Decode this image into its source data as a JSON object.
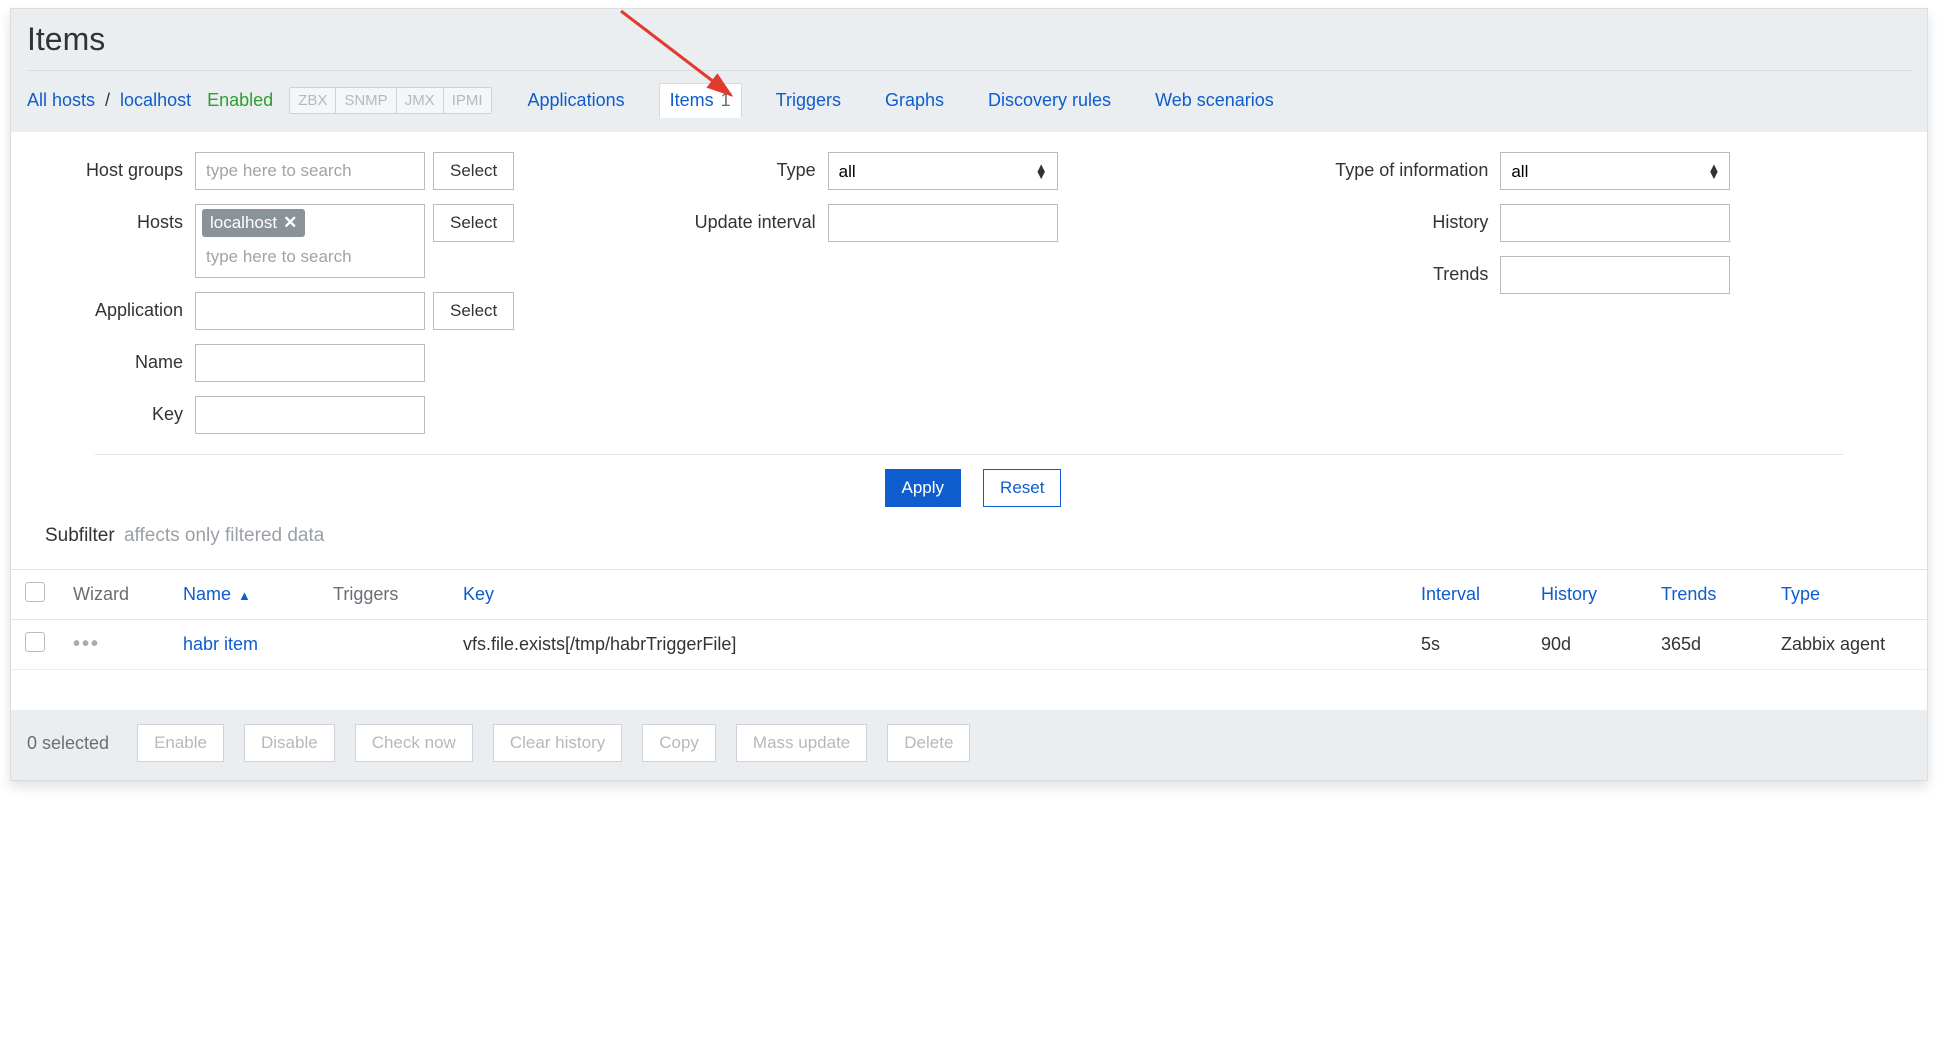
{
  "page_title": "Items",
  "breadcrumb": {
    "all_hosts": "All hosts",
    "host": "localhost"
  },
  "status_enabled": "Enabled",
  "protocols": [
    "ZBX",
    "SNMP",
    "JMX",
    "IPMI"
  ],
  "tabs": {
    "applications": "Applications",
    "items_label": "Items",
    "items_count": "1",
    "triggers": "Triggers",
    "graphs": "Graphs",
    "discovery": "Discovery rules",
    "web": "Web scenarios"
  },
  "filter": {
    "labels": {
      "host_groups": "Host groups",
      "hosts": "Hosts",
      "application": "Application",
      "name": "Name",
      "key": "Key",
      "type": "Type",
      "update_interval": "Update interval",
      "type_of_info": "Type of information",
      "history": "History",
      "trends": "Trends"
    },
    "placeholder_search": "type here to search",
    "host_token": "localhost",
    "select_btn": "Select",
    "type_value": "all",
    "type_of_info_value": "all",
    "apply": "Apply",
    "reset": "Reset"
  },
  "subfilter": {
    "label": "Subfilter",
    "note": "affects only filtered data"
  },
  "table": {
    "headers": {
      "wizard": "Wizard",
      "name": "Name",
      "triggers": "Triggers",
      "key": "Key",
      "interval": "Interval",
      "history": "History",
      "trends": "Trends",
      "type": "Type"
    },
    "row": {
      "name": "habr item",
      "key": "vfs.file.exists[/tmp/habrTriggerFile]",
      "interval": "5s",
      "history": "90d",
      "trends": "365d",
      "type": "Zabbix agent"
    }
  },
  "footer": {
    "selected": "0 selected",
    "buttons": [
      "Enable",
      "Disable",
      "Check now",
      "Clear history",
      "Copy",
      "Mass update",
      "Delete"
    ]
  }
}
